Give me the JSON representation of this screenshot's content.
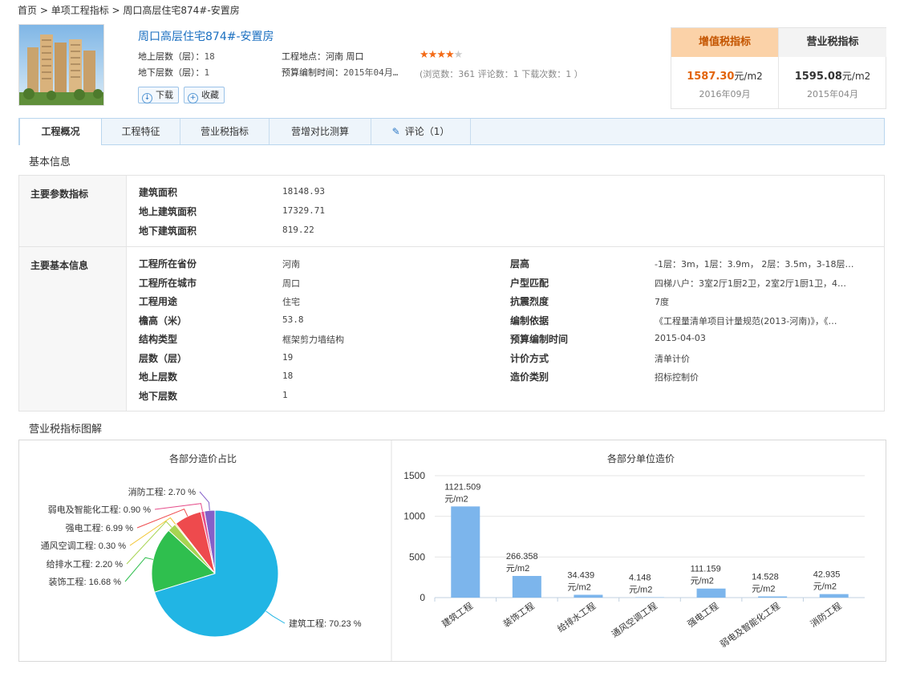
{
  "breadcrumb": [
    "首页",
    "单项工程指标",
    "周口高层住宅874#-安置房"
  ],
  "breadcrumb_sep": " > ",
  "project": {
    "title": "周口高层住宅874#-安置房",
    "above_floors_label": "地上层数（层）：",
    "above_floors": "18",
    "below_floors_label": "地下层数（层）：",
    "below_floors": "1",
    "location_label": "工程地点：",
    "location": "河南 周口",
    "budget_time_label": "预算编制时间：",
    "budget_time": "2015年04月…",
    "rating": 4,
    "rating_max": 5,
    "stats": "(浏览数：361 评论数：1 下载次数：1 ）",
    "download_label": "下载",
    "favorite_label": "收藏"
  },
  "tax": {
    "vat_label": "增值税指标",
    "vat_value": "1587.30",
    "vat_unit": "元/m2",
    "vat_date": "2016年09月",
    "bt_label": "营业税指标",
    "bt_value": "1595.08",
    "bt_unit": "元/m2",
    "bt_date": "2015年04月"
  },
  "tabs": [
    "工程概况",
    "工程特征",
    "营业税指标",
    "营增对比测算",
    "评论（1）"
  ],
  "basic": {
    "section_title": "基本信息",
    "main_params_title": "主要参数指标",
    "main_params": [
      {
        "label": "建筑面积",
        "value": "18148.93"
      },
      {
        "label": "地上建筑面积",
        "value": "17329.71"
      },
      {
        "label": "地下建筑面积",
        "value": "819.22"
      }
    ],
    "main_info_title": "主要基本信息",
    "left": [
      {
        "label": "工程所在省份",
        "value": "河南"
      },
      {
        "label": "工程所在城市",
        "value": "周口"
      },
      {
        "label": "工程用途",
        "value": "住宅"
      },
      {
        "label": "檐高（米）",
        "value": "53.8"
      },
      {
        "label": "结构类型",
        "value": "框架剪力墙结构"
      },
      {
        "label": "层数（层）",
        "value": "19"
      },
      {
        "label": "地上层数",
        "value": "18"
      },
      {
        "label": "地下层数",
        "value": "1"
      }
    ],
    "right": [
      {
        "label": "层高",
        "value": "-1层：3m，1层：3.9m， 2层：3.5m，3-18层…"
      },
      {
        "label": "户型匹配",
        "value": "四梯八户：3室2厅1厨2卫，2室2厅1厨1卫，4…"
      },
      {
        "label": "抗震烈度",
        "value": "7度"
      },
      {
        "label": "编制依据",
        "value": "《工程量清单项目计量规范(2013-河南)》，《…"
      },
      {
        "label": "预算编制时间",
        "value": "2015-04-03"
      },
      {
        "label": "计价方式",
        "value": "清单计价"
      },
      {
        "label": "造价类别",
        "value": "招标控制价"
      }
    ]
  },
  "charts_section_title": "营业税指标图解",
  "colors": {
    "accent": "#1a6fc0",
    "vat_orange": "#e2640c",
    "vat_bg": "#fbd2a8",
    "bar": "#7cb5ec"
  },
  "chart_data": [
    {
      "type": "pie",
      "title": "各部分造价占比",
      "slices": [
        {
          "name": "建筑工程",
          "value": 70.23,
          "label": "建筑工程: 70.23 %",
          "color": "#21b5e4"
        },
        {
          "name": "装饰工程",
          "value": 16.68,
          "label": "装饰工程: 16.68 %",
          "color": "#2fbf4e"
        },
        {
          "name": "给排水工程",
          "value": 2.2,
          "label": "给排水工程: 2.20 %",
          "color": "#a7d451"
        },
        {
          "name": "通风空调工程",
          "value": 0.3,
          "label": "通风空调工程: 0.30 %",
          "color": "#f2c42b"
        },
        {
          "name": "强电工程",
          "value": 6.99,
          "label": "强电工程: 6.99 %",
          "color": "#ee4a4d"
        },
        {
          "name": "弱电及智能化工程",
          "value": 0.9,
          "label": "弱电及智能化工程: 0.90 %",
          "color": "#e6508c"
        },
        {
          "name": "消防工程",
          "value": 2.7,
          "label": "消防工程: 2.70 %",
          "color": "#8460c8"
        }
      ]
    },
    {
      "type": "bar",
      "title": "各部分单位造价",
      "categories": [
        "建筑工程",
        "装饰工程",
        "给排水工程",
        "通风空调工程",
        "强电工程",
        "弱电及智能化工程",
        "消防工程"
      ],
      "values": [
        1121.509,
        266.358,
        34.439,
        4.148,
        111.159,
        14.528,
        42.935
      ],
      "value_labels": [
        "1121.509",
        "266.358",
        "34.439",
        "4.148",
        "111.159",
        "14.528",
        "42.935"
      ],
      "unit": "元/m2",
      "ylim": [
        0,
        1500
      ],
      "yticks": [
        0,
        500,
        1000,
        1500
      ],
      "grid": true
    }
  ]
}
